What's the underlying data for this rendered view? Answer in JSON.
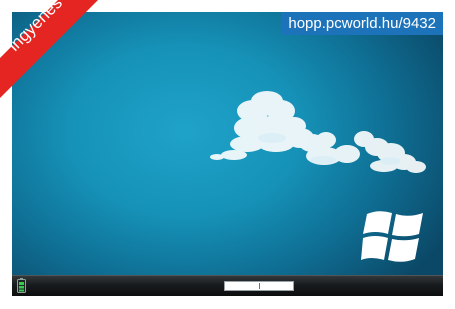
{
  "banner": {
    "text": "ingyenes",
    "color": "#e52521"
  },
  "link_badge": {
    "url": "hopp.pcworld.hu/9432",
    "color": "#1d73b9"
  },
  "desktop": {
    "wallpaper": "blue-sky-with-cloud",
    "logo": "windows-logo-icon"
  },
  "taskbar": {
    "battery_icon": "battery-icon",
    "progress_fraction": 0.5
  }
}
